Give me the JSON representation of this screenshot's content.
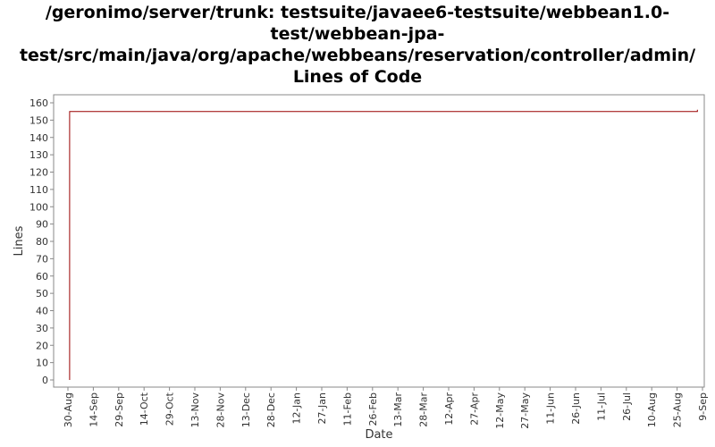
{
  "chart_data": {
    "type": "line",
    "title_lines": [
      "/geronimo/server/trunk: testsuite/javaee6-testsuite/webbean1.0-",
      "test/webbean-jpa-",
      "test/src/main/java/org/apache/webbeans/reservation/controller/admin/",
      "Lines of Code"
    ],
    "xlabel": "Date",
    "ylabel": "Lines",
    "ylim": [
      0,
      165
    ],
    "y_ticks": [
      0,
      10,
      20,
      30,
      40,
      50,
      60,
      70,
      80,
      90,
      100,
      110,
      120,
      130,
      140,
      150,
      160
    ],
    "x_range": [
      "2009-08-30",
      "2010-09-09"
    ],
    "x_ticks": [
      {
        "date": "2009-08-30",
        "label": "30-Aug"
      },
      {
        "date": "2009-09-14",
        "label": "14-Sep"
      },
      {
        "date": "2009-09-29",
        "label": "29-Sep"
      },
      {
        "date": "2009-10-14",
        "label": "14-Oct"
      },
      {
        "date": "2009-10-29",
        "label": "29-Oct"
      },
      {
        "date": "2009-11-13",
        "label": "13-Nov"
      },
      {
        "date": "2009-11-28",
        "label": "28-Nov"
      },
      {
        "date": "2009-12-13",
        "label": "13-Dec"
      },
      {
        "date": "2009-12-28",
        "label": "28-Dec"
      },
      {
        "date": "2010-01-12",
        "label": "12-Jan"
      },
      {
        "date": "2010-01-27",
        "label": "27-Jan"
      },
      {
        "date": "2010-02-11",
        "label": "11-Feb"
      },
      {
        "date": "2010-02-26",
        "label": "26-Feb"
      },
      {
        "date": "2010-03-13",
        "label": "13-Mar"
      },
      {
        "date": "2010-03-28",
        "label": "28-Mar"
      },
      {
        "date": "2010-04-12",
        "label": "12-Apr"
      },
      {
        "date": "2010-04-27",
        "label": "27-Apr"
      },
      {
        "date": "2010-05-12",
        "label": "12-May"
      },
      {
        "date": "2010-05-27",
        "label": "27-May"
      },
      {
        "date": "2010-06-11",
        "label": "11-Jun"
      },
      {
        "date": "2010-06-26",
        "label": "26-Jun"
      },
      {
        "date": "2010-07-11",
        "label": "11-Jul"
      },
      {
        "date": "2010-07-26",
        "label": "26-Jul"
      },
      {
        "date": "2010-08-10",
        "label": "10-Aug"
      },
      {
        "date": "2010-08-25",
        "label": "25-Aug"
      },
      {
        "date": "2010-09-09",
        "label": "9-Sep"
      }
    ],
    "series": [
      {
        "color": "#990000",
        "points": [
          {
            "x": "2009-08-31",
            "y": 0
          },
          {
            "x": "2009-08-31",
            "y": 155
          },
          {
            "x": "2010-09-06",
            "y": 155
          },
          {
            "x": "2010-09-06",
            "y": 156
          }
        ]
      }
    ],
    "grid": false,
    "legend": "none"
  }
}
